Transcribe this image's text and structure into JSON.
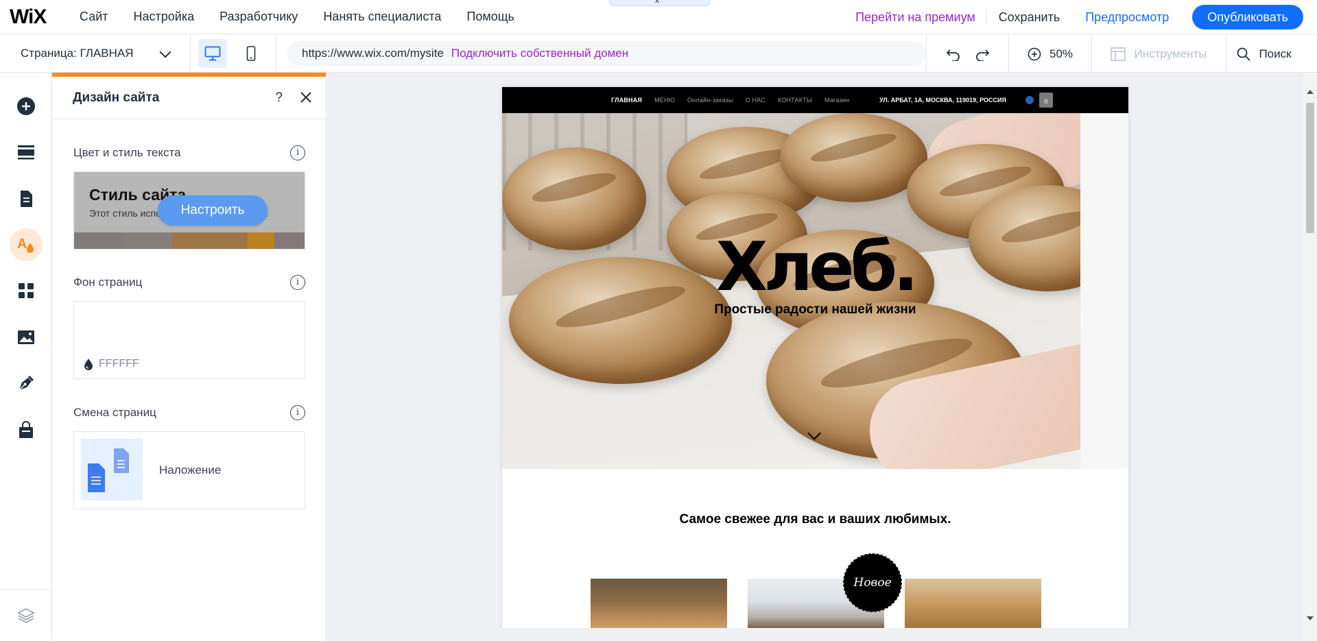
{
  "app": {
    "logo": "WiX",
    "menu": [
      "Сайт",
      "Настройка",
      "Разработчику",
      "Нанять специалиста",
      "Помощь"
    ],
    "premium_link": "Перейти на премиум",
    "save_label": "Сохранить",
    "preview_label": "Предпросмотр",
    "publish_label": "Опубликовать"
  },
  "subbar": {
    "page_selector": "Страница: ГЛАВНАЯ",
    "url": "https://www.wix.com/mysite",
    "connect_domain": "Подключить собственный домен",
    "zoom": "50%",
    "tools_label": "Инструменты",
    "search_label": "Поиск"
  },
  "panel": {
    "title": "Дизайн сайта",
    "help": "?",
    "text_section": "Цвет и стиль текста",
    "style_title": "Стиль сайта",
    "style_sub": "Этот стиль используется на всем сайте.",
    "customize_button": "Настроить",
    "swatch_colors": [
      "#817b79",
      "#817b79",
      "#9c7648",
      "#ba8123",
      "#847978"
    ],
    "bg_section": "Фон страниц",
    "bg_hex": "FFFFFF",
    "transition_section": "Смена страниц",
    "transition_value": "Наложение"
  },
  "site": {
    "nav": [
      "ГЛАВНАЯ",
      "МЕНЮ",
      "Онлайн-заказы",
      "О НАС",
      "КОНТАКТЫ",
      "Магазин"
    ],
    "address": "УЛ. АРБАТ, 1А, МОСКВА, 119019, РОССИЯ",
    "cart_count": "0",
    "hero_title": "Хлеб.",
    "hero_subtitle": "Простые радости нашей жизни",
    "section_title": "Самое свежее для вас и ваших любимых.",
    "badge": "Новое"
  },
  "colors": {
    "accent": "#116dff",
    "premium": "#9a27d5",
    "panel_accent": "#fb8b1c"
  }
}
